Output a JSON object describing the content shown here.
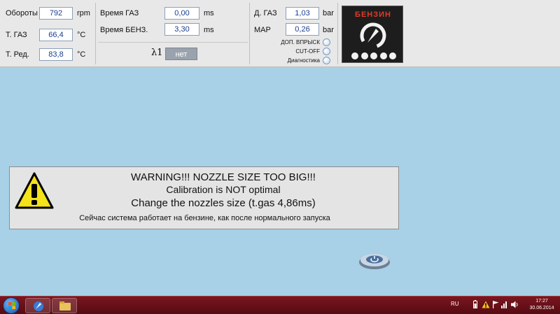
{
  "sensors": {
    "rpm": {
      "label": "Обороты",
      "value": "792",
      "unit": "rpm"
    },
    "t_gas": {
      "label": "Т. ГАЗ",
      "value": "66,4",
      "unit": "°C"
    },
    "t_red": {
      "label": "Т. Ред.",
      "value": "83,8",
      "unit": "°C"
    }
  },
  "timing": {
    "gas_time": {
      "label": "Время ГАЗ",
      "value": "0,00",
      "unit": "ms"
    },
    "petrol_time": {
      "label": "Время БЕНЗ.",
      "value": "3,30",
      "unit": "ms"
    },
    "lambda_label": "λ1",
    "lambda_value": "нет"
  },
  "pressure": {
    "gas": {
      "label": "Д. ГАЗ",
      "value": "1,03",
      "unit": "bar"
    },
    "map": {
      "label": "MAP",
      "value": "0,26",
      "unit": "bar"
    }
  },
  "options": {
    "extra_injection": "ДОП. ВПРЫСК",
    "cut_off": "CUT-OFF",
    "diagnostics": "Диагностика"
  },
  "mode": {
    "label": "БЕНЗИН",
    "accent_color": "#e03a2a"
  },
  "warning": {
    "line1": "WARNING!!! NOZZLE SIZE TOO BIG!!!",
    "line2": "Calibration is NOT optimal",
    "line3": "Change the nozzles size (t.gas 4,86ms)",
    "line4": "Сейчас система работает на бензине, как после нормального запуска",
    "icon": "warning-triangle-icon"
  },
  "taskbar": {
    "language": "RU",
    "time": "17:27",
    "date": "30.06.2014"
  }
}
